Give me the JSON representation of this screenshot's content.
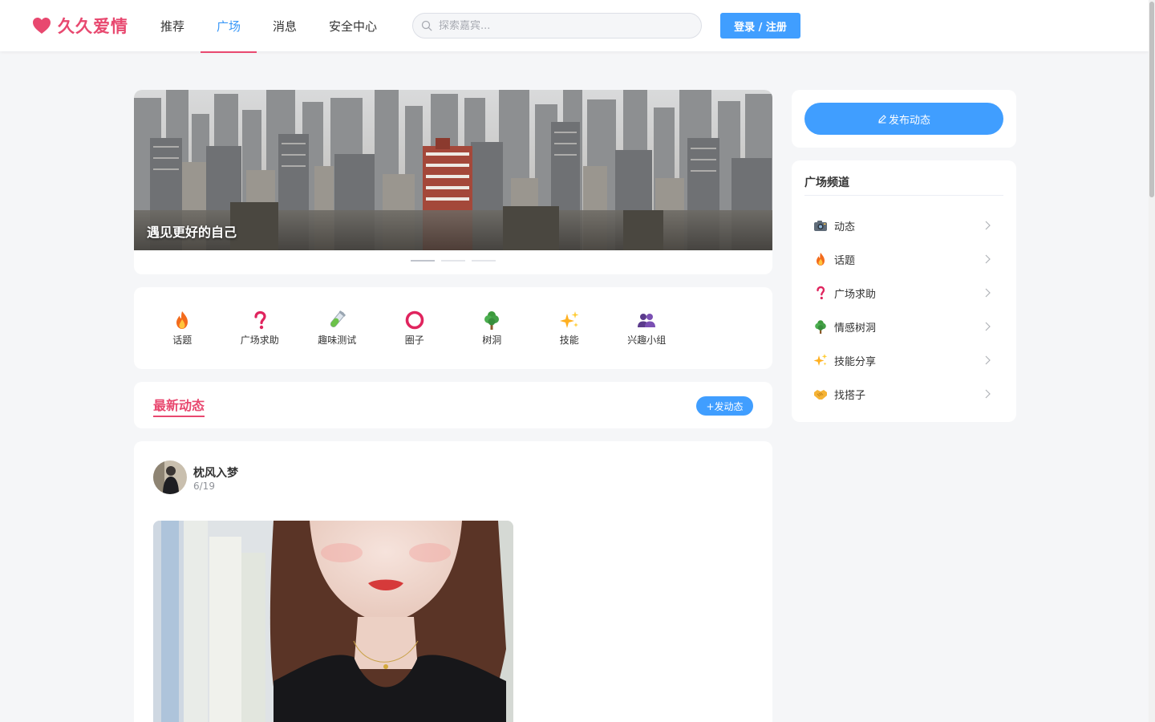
{
  "header": {
    "logo_text": "久久爱情",
    "nav": [
      "推荐",
      "广场",
      "消息",
      "安全中心"
    ],
    "active_nav": "广场",
    "search_placeholder": "探索嘉宾...",
    "login_label": "登录 / 注册"
  },
  "banner": {
    "caption": "遇见更好的自己",
    "slide_count": 3,
    "active_slide": 1
  },
  "categories": [
    {
      "label": "话题",
      "icon": "fire-icon"
    },
    {
      "label": "广场求助",
      "icon": "question-icon"
    },
    {
      "label": "趣味测试",
      "icon": "test-tube-icon"
    },
    {
      "label": "圈子",
      "icon": "circle-icon"
    },
    {
      "label": "树洞",
      "icon": "tree-icon"
    },
    {
      "label": "技能",
      "icon": "sparkles-icon"
    },
    {
      "label": "兴趣小组",
      "icon": "group-icon"
    }
  ],
  "latest": {
    "title": "最新动态",
    "post_button": "+发动态"
  },
  "post": {
    "username": "枕风入梦",
    "date": "6/19"
  },
  "sidebar": {
    "publish_button": "发布动态",
    "channel_title": "广场频道",
    "channels": [
      {
        "label": "动态",
        "icon": "camera-icon"
      },
      {
        "label": "话题",
        "icon": "fire-icon"
      },
      {
        "label": "广场求助",
        "icon": "question-icon"
      },
      {
        "label": "情感树洞",
        "icon": "tree-icon"
      },
      {
        "label": "技能分享",
        "icon": "sparkles-icon"
      },
      {
        "label": "找搭子",
        "icon": "handshake-icon"
      }
    ]
  },
  "colors": {
    "brand": "#e8486f",
    "primary": "#409eff",
    "active_nav_text": "#3a98f8",
    "page_bg": "#f5f6f8"
  }
}
